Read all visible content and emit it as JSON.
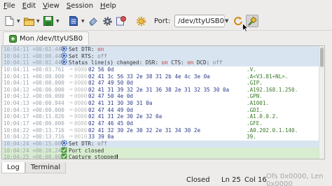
{
  "menubar": {
    "items": [
      {
        "label": "File",
        "u": "F",
        "rest": "ile"
      },
      {
        "label": "Edit",
        "u": "E",
        "rest": "dit"
      },
      {
        "label": "View",
        "u": "V",
        "rest": "iew"
      },
      {
        "label": "Session",
        "u": "S",
        "rest": "ession"
      },
      {
        "label": "Help",
        "u": "H",
        "rest": "elp"
      }
    ]
  },
  "toolbar": {
    "port_label": "Port:",
    "port_value": "/dev/ttyUSB0"
  },
  "tab": {
    "title": "Mon /dev/ttyUSB0"
  },
  "log": {
    "rows": [
      {
        "kind": "ctrl",
        "ts": "10:04:11 +00:02.444",
        "text": "Set DTR: on",
        "parts": [
          {
            "t": "Set DTR: "
          },
          {
            "t": "on",
            "c": "on"
          }
        ]
      },
      {
        "kind": "ctrl",
        "ts": "10:04:11 +00:00.444",
        "parts": [
          {
            "t": "Set RTS: "
          },
          {
            "t": "off",
            "c": "offw"
          }
        ]
      },
      {
        "kind": "ctrl",
        "ts": "10:04:11 +00:02.444",
        "parts": [
          {
            "t": "Status line(s) changed: DSR: "
          },
          {
            "t": "on",
            "c": "on"
          },
          {
            "t": " CTS: "
          },
          {
            "t": "on",
            "c": "on"
          },
          {
            "t": " DCD: "
          },
          {
            "t": "off",
            "c": "offw"
          }
        ]
      },
      {
        "kind": "data",
        "ts": "10:04:11 +00:03.761",
        "off": "0000",
        "hex": "02 56 0d",
        "asc": ".V."
      },
      {
        "kind": "data",
        "ts": "10:04:11 +00:00.000",
        "off": "0000",
        "hex": "02 41 3c 56 33 2e 38 31 2b 4e 4c 3e 0a",
        "asc": ".A<V3.81+NL>."
      },
      {
        "kind": "data",
        "ts": "10:04:11 +00:00.000",
        "off": "0000",
        "hex": "02 47 49 50 0d",
        "asc": ".GIP."
      },
      {
        "kind": "data",
        "ts": "10:04:12 +00:00.000",
        "off": "0000",
        "hex": "02 41 31 39 32 2e 31 36 38 2e 31 32 35 30 0a",
        "asc": ".A192.168.1.250."
      },
      {
        "kind": "data",
        "ts": "10:04:12 +00:00.000",
        "off": "0000",
        "hex": "02 47 50 4e 0d",
        "asc": ".GPN."
      },
      {
        "kind": "data",
        "ts": "10:04:13 +00:00.944",
        "off": "0000",
        "hex": "02 41 31 30 30 31 0a",
        "asc": ".A1001."
      },
      {
        "kind": "data",
        "ts": "10:04:13 +00:00.000",
        "off": "0000",
        "hex": "02 47 44 49 0d",
        "asc": ".GDI."
      },
      {
        "kind": "data",
        "ts": "10:04:17 +00:11.026",
        "off": "0000",
        "hex": "02 41 31 2e 30 2e 32 0a",
        "asc": ".A1.0.0.2."
      },
      {
        "kind": "data",
        "ts": "10:04:17 +00:00.000",
        "off": "0000",
        "hex": "02 47 46 45 0d",
        "asc": ".GFE."
      },
      {
        "kind": "data",
        "ts": "10:04:22 +00:13.716",
        "off": "0000",
        "hex": "02 41 32 30 2e 30 32 2e 31 34 30 2e",
        "asc": ".A0.202.0.1.140."
      },
      {
        "kind": "data2",
        "ts": "10:04:22 +00:13.716",
        "off": "0010",
        "hex": "33 39 0a",
        "asc": "39."
      },
      {
        "kind": "ctrl",
        "ts": "10:04:24 +00:15.007",
        "parts": [
          {
            "t": "Set DTR: "
          },
          {
            "t": "off",
            "c": "offw"
          }
        ]
      },
      {
        "kind": "ok",
        "ts": "10:04:24 +00:10.240",
        "parts": [
          {
            "t": "Port closed"
          }
        ]
      },
      {
        "kind": "ok",
        "ts": "10:04:25 +00:00.000",
        "parts": [
          {
            "t": "Capture stopped"
          }
        ],
        "caret": true
      }
    ]
  },
  "bottom_tabs": [
    {
      "label": "Log",
      "active": true
    },
    {
      "label": "Terminal",
      "active": false
    }
  ],
  "status": {
    "state": "Closed",
    "line": "Ln 25",
    "col": "Col 16",
    "offset": "Ofs 0x0000, Len 0x0000"
  },
  "colors": {
    "ctrl_row_bg": "#d9e4f1",
    "ok_row_bg": "#d8ecd0",
    "hex_color": "#2a3b8c",
    "ascii_color": "#3a7a26",
    "on_color": "#c0392b"
  }
}
